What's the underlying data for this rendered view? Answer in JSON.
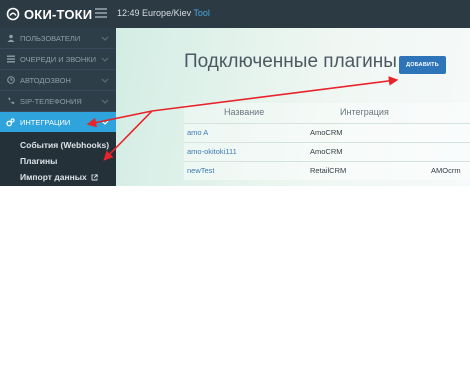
{
  "app": {
    "logo_text": "ОКИ-ТОКИ",
    "time": "12:49",
    "timezone": "Europe/Kiev",
    "timezone_link": "Tool"
  },
  "sidebar": {
    "items": [
      {
        "label": "ПОЛЬЗОВАТЕЛИ",
        "icon": "user-icon"
      },
      {
        "label": "ОЧЕРЕДИ И ЗВОНКИ",
        "icon": "list-icon"
      },
      {
        "label": "АВТОДОЗВОН",
        "icon": "clock-icon"
      },
      {
        "label": "SIP-ТЕЛЕФОНИЯ",
        "icon": "phone-icon"
      },
      {
        "label": "ИНТЕГРАЦИИ",
        "icon": "cogs-icon",
        "active": true
      }
    ],
    "submenu": [
      {
        "label": "События (Webhooks)"
      },
      {
        "label": "Плагины"
      },
      {
        "label": "Импорт данных"
      }
    ]
  },
  "main": {
    "title": "Подключенные плагины",
    "add_button": "ДОБАВИТЬ",
    "table": {
      "headers": [
        "Название",
        "Интеграция"
      ],
      "rows": [
        {
          "name": "amo A",
          "integration": "AmoCRM",
          "extra": ""
        },
        {
          "name": "amo-okitoki111",
          "integration": "AmoCRM",
          "extra": ""
        },
        {
          "name": "newTest",
          "integration": "RetailCRM",
          "extra": "AMOcrm"
        }
      ]
    }
  },
  "colors": {
    "sidebar_bg": "#2e3e49",
    "active_item": "#2ea3dc",
    "button": "#2d74b9",
    "annotation_arrow": "#e8242b"
  }
}
